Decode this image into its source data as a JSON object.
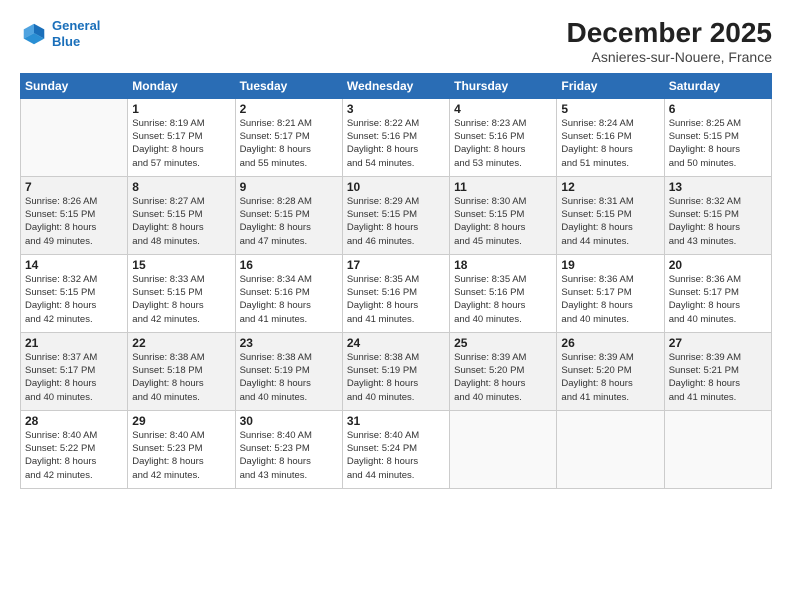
{
  "logo": {
    "line1": "General",
    "line2": "Blue"
  },
  "title": "December 2025",
  "subtitle": "Asnieres-sur-Nouere, France",
  "days_header": [
    "Sunday",
    "Monday",
    "Tuesday",
    "Wednesday",
    "Thursday",
    "Friday",
    "Saturday"
  ],
  "weeks": [
    [
      {
        "day": "",
        "info": ""
      },
      {
        "day": "1",
        "info": "Sunrise: 8:19 AM\nSunset: 5:17 PM\nDaylight: 8 hours\nand 57 minutes."
      },
      {
        "day": "2",
        "info": "Sunrise: 8:21 AM\nSunset: 5:17 PM\nDaylight: 8 hours\nand 55 minutes."
      },
      {
        "day": "3",
        "info": "Sunrise: 8:22 AM\nSunset: 5:16 PM\nDaylight: 8 hours\nand 54 minutes."
      },
      {
        "day": "4",
        "info": "Sunrise: 8:23 AM\nSunset: 5:16 PM\nDaylight: 8 hours\nand 53 minutes."
      },
      {
        "day": "5",
        "info": "Sunrise: 8:24 AM\nSunset: 5:16 PM\nDaylight: 8 hours\nand 51 minutes."
      },
      {
        "day": "6",
        "info": "Sunrise: 8:25 AM\nSunset: 5:15 PM\nDaylight: 8 hours\nand 50 minutes."
      }
    ],
    [
      {
        "day": "7",
        "info": "Sunrise: 8:26 AM\nSunset: 5:15 PM\nDaylight: 8 hours\nand 49 minutes."
      },
      {
        "day": "8",
        "info": "Sunrise: 8:27 AM\nSunset: 5:15 PM\nDaylight: 8 hours\nand 48 minutes."
      },
      {
        "day": "9",
        "info": "Sunrise: 8:28 AM\nSunset: 5:15 PM\nDaylight: 8 hours\nand 47 minutes."
      },
      {
        "day": "10",
        "info": "Sunrise: 8:29 AM\nSunset: 5:15 PM\nDaylight: 8 hours\nand 46 minutes."
      },
      {
        "day": "11",
        "info": "Sunrise: 8:30 AM\nSunset: 5:15 PM\nDaylight: 8 hours\nand 45 minutes."
      },
      {
        "day": "12",
        "info": "Sunrise: 8:31 AM\nSunset: 5:15 PM\nDaylight: 8 hours\nand 44 minutes."
      },
      {
        "day": "13",
        "info": "Sunrise: 8:32 AM\nSunset: 5:15 PM\nDaylight: 8 hours\nand 43 minutes."
      }
    ],
    [
      {
        "day": "14",
        "info": "Sunrise: 8:32 AM\nSunset: 5:15 PM\nDaylight: 8 hours\nand 42 minutes."
      },
      {
        "day": "15",
        "info": "Sunrise: 8:33 AM\nSunset: 5:15 PM\nDaylight: 8 hours\nand 42 minutes."
      },
      {
        "day": "16",
        "info": "Sunrise: 8:34 AM\nSunset: 5:16 PM\nDaylight: 8 hours\nand 41 minutes."
      },
      {
        "day": "17",
        "info": "Sunrise: 8:35 AM\nSunset: 5:16 PM\nDaylight: 8 hours\nand 41 minutes."
      },
      {
        "day": "18",
        "info": "Sunrise: 8:35 AM\nSunset: 5:16 PM\nDaylight: 8 hours\nand 40 minutes."
      },
      {
        "day": "19",
        "info": "Sunrise: 8:36 AM\nSunset: 5:17 PM\nDaylight: 8 hours\nand 40 minutes."
      },
      {
        "day": "20",
        "info": "Sunrise: 8:36 AM\nSunset: 5:17 PM\nDaylight: 8 hours\nand 40 minutes."
      }
    ],
    [
      {
        "day": "21",
        "info": "Sunrise: 8:37 AM\nSunset: 5:17 PM\nDaylight: 8 hours\nand 40 minutes."
      },
      {
        "day": "22",
        "info": "Sunrise: 8:38 AM\nSunset: 5:18 PM\nDaylight: 8 hours\nand 40 minutes."
      },
      {
        "day": "23",
        "info": "Sunrise: 8:38 AM\nSunset: 5:19 PM\nDaylight: 8 hours\nand 40 minutes."
      },
      {
        "day": "24",
        "info": "Sunrise: 8:38 AM\nSunset: 5:19 PM\nDaylight: 8 hours\nand 40 minutes."
      },
      {
        "day": "25",
        "info": "Sunrise: 8:39 AM\nSunset: 5:20 PM\nDaylight: 8 hours\nand 40 minutes."
      },
      {
        "day": "26",
        "info": "Sunrise: 8:39 AM\nSunset: 5:20 PM\nDaylight: 8 hours\nand 41 minutes."
      },
      {
        "day": "27",
        "info": "Sunrise: 8:39 AM\nSunset: 5:21 PM\nDaylight: 8 hours\nand 41 minutes."
      }
    ],
    [
      {
        "day": "28",
        "info": "Sunrise: 8:40 AM\nSunset: 5:22 PM\nDaylight: 8 hours\nand 42 minutes."
      },
      {
        "day": "29",
        "info": "Sunrise: 8:40 AM\nSunset: 5:23 PM\nDaylight: 8 hours\nand 42 minutes."
      },
      {
        "day": "30",
        "info": "Sunrise: 8:40 AM\nSunset: 5:23 PM\nDaylight: 8 hours\nand 43 minutes."
      },
      {
        "day": "31",
        "info": "Sunrise: 8:40 AM\nSunset: 5:24 PM\nDaylight: 8 hours\nand 44 minutes."
      },
      {
        "day": "",
        "info": ""
      },
      {
        "day": "",
        "info": ""
      },
      {
        "day": "",
        "info": ""
      }
    ]
  ]
}
